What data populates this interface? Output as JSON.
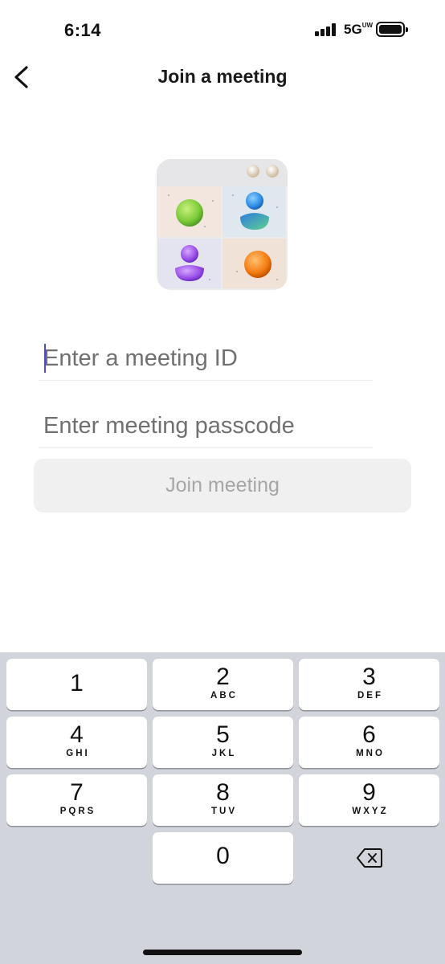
{
  "status_bar": {
    "time": "6:14",
    "network": "5G",
    "network_suffix": "UW",
    "icons": [
      "signal-icon",
      "battery-icon"
    ]
  },
  "nav": {
    "back_icon": "chevron-left-icon",
    "title": "Join a meeting"
  },
  "illustration": {
    "description_icon": "meeting-grid-illustration"
  },
  "form": {
    "meeting_id_placeholder": "Enter a meeting ID",
    "meeting_id_value": "",
    "passcode_placeholder": "Enter meeting passcode",
    "passcode_value": "",
    "join_label": "Join meeting"
  },
  "keypad": {
    "keys": [
      {
        "digit": "1",
        "letters": ""
      },
      {
        "digit": "2",
        "letters": "ABC"
      },
      {
        "digit": "3",
        "letters": "DEF"
      },
      {
        "digit": "4",
        "letters": "GHI"
      },
      {
        "digit": "5",
        "letters": "JKL"
      },
      {
        "digit": "6",
        "letters": "MNO"
      },
      {
        "digit": "7",
        "letters": "PQRS"
      },
      {
        "digit": "8",
        "letters": "TUV"
      },
      {
        "digit": "9",
        "letters": "WXYZ"
      },
      {
        "digit": "0",
        "letters": ""
      }
    ],
    "delete_icon": "backspace-icon"
  },
  "colors": {
    "cursor": "#4a4ae0",
    "keypad_bg": "#d2d4dc",
    "button_disabled_bg": "#f0f0f0",
    "button_disabled_text": "#a6a6a6"
  }
}
